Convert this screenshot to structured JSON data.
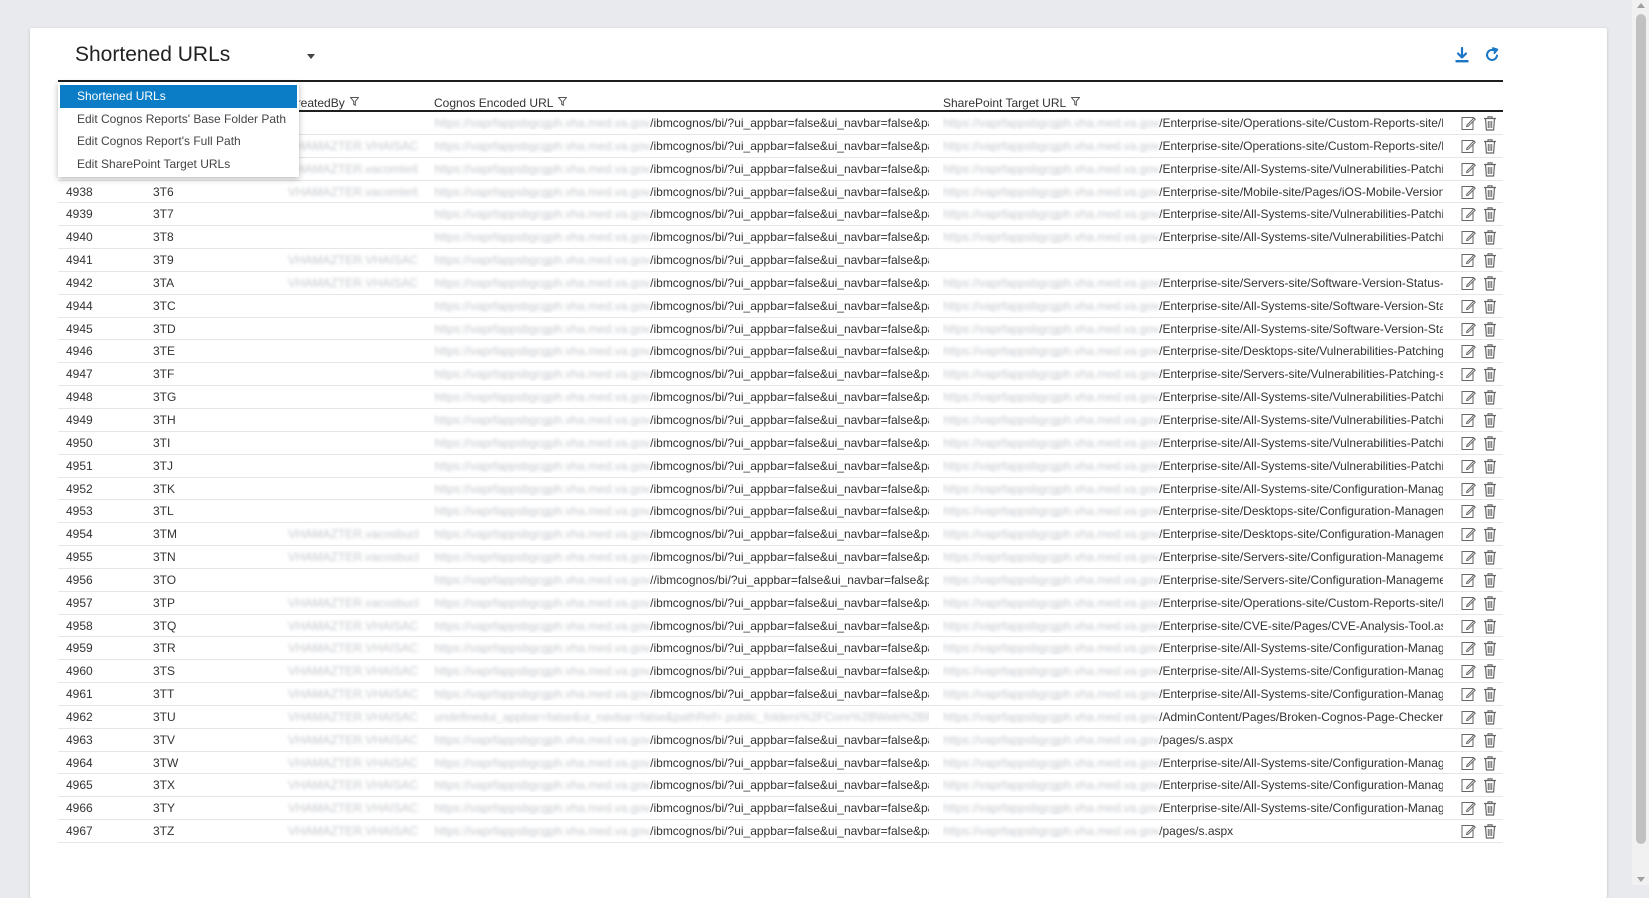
{
  "view_selector": {
    "label": "Shortened URLs"
  },
  "menu": [
    "Shortened URLs",
    "Edit Cognos Reports' Base Folder Path",
    "Edit Cognos Report's Full Path",
    "Edit SharePoint Target URLs"
  ],
  "toolbar": {
    "download_icon": "download-icon",
    "refresh_icon": "refresh-icon"
  },
  "columns": {
    "id": "",
    "code": "",
    "created_by": "CreatedBy",
    "cognos_url": "Cognos Encoded URL",
    "sharepoint_url": "SharePoint Target URL"
  },
  "colors": {
    "accent": "#0b7dc6",
    "selected_text": "#ffffff",
    "rule": "#1f1f1f"
  },
  "rows": [
    {
      "id": "",
      "code": "",
      "created_by": "",
      "cognos_host": "https://vaprfappsbgcgph.vha.med.va.gov",
      "cognos": "/ibmcognos/bi/?ui_appbar=false&ui_navbar=false&pat...",
      "sp_host": "https://vaprfappsbgcgph.vha.med.va.gov",
      "sp": "/Enterprise-site/Operations-site/Custom-Reports-site/P..."
    },
    {
      "id": "",
      "code": "",
      "created_by": "VHAMAZTER.VHAISAC",
      "cognos_host": "https://vaprfappsbgcgph.vha.med.va.gov",
      "cognos": "/ibmcognos/bi/?ui_appbar=false&ui_navbar=false&pat...",
      "sp_host": "https://vaprfappsbgcgph.vha.med.va.gov",
      "sp": "/Enterprise-site/Operations-site/Custom-Reports-site/P..."
    },
    {
      "id": "",
      "code": "",
      "created_by": "VHAMAZTER.vacomlerb",
      "cognos_host": "https://vaprfappsbgcgph.vha.med.va.gov",
      "cognos": "/ibmcognos/bi/?ui_appbar=false&ui_navbar=false&pat...",
      "sp_host": "https://vaprfappsbgcgph.vha.med.va.gov",
      "sp": "/Enterprise-site/All-Systems-site/Vulnerabilities-Patchi..."
    },
    {
      "id": "4938",
      "code": "3T6",
      "created_by": "VHAMAZTER.vacomlerb",
      "cognos_host": "https://vaprfappsbgcgph.vha.med.va.gov",
      "cognos": "/ibmcognos/bi/?ui_appbar=false&ui_navbar=false&pat...",
      "sp_host": "https://vaprfappsbgcgph.vha.med.va.gov",
      "sp": "/Enterprise-site/Mobile-site/Pages/iOS-Mobile-Version-..."
    },
    {
      "id": "4939",
      "code": "3T7",
      "created_by": "",
      "cognos_host": "https://vaprfappsbgcgph.vha.med.va.gov",
      "cognos": "/ibmcognos/bi/?ui_appbar=false&ui_navbar=false&pat...",
      "sp_host": "https://vaprfappsbgcgph.vha.med.va.gov",
      "sp": "/Enterprise-site/All-Systems-site/Vulnerabilities-Patchi..."
    },
    {
      "id": "4940",
      "code": "3T8",
      "created_by": "",
      "cognos_host": "https://vaprfappsbgcgph.vha.med.va.gov",
      "cognos": "/ibmcognos/bi/?ui_appbar=false&ui_navbar=false&pat...",
      "sp_host": "https://vaprfappsbgcgph.vha.med.va.gov",
      "sp": "/Enterprise-site/All-Systems-site/Vulnerabilities-Patchi..."
    },
    {
      "id": "4941",
      "code": "3T9",
      "created_by": "VHAMAZTER.VHAISAC",
      "cognos_host": "https://vaprfappsbgcgph.vha.med.va.gov",
      "cognos": "/ibmcognos/bi/?ui_appbar=false&ui_navbar=false&pat...",
      "sp_host": "",
      "sp": ""
    },
    {
      "id": "4942",
      "code": "3TA",
      "created_by": "VHAMAZTER.VHAISAC",
      "cognos_host": "https://vaprfappsbgcgph.vha.med.va.gov",
      "cognos": "/ibmcognos/bi/?ui_appbar=false&ui_navbar=false&pat...",
      "sp_host": "https://vaprfappsbgcgph.vha.med.va.gov",
      "sp": "/Enterprise-site/Servers-site/Software-Version-Status-s..."
    },
    {
      "id": "4944",
      "code": "3TC",
      "created_by": "",
      "cognos_host": "https://vaprfappsbgcgph.vha.med.va.gov",
      "cognos": "/ibmcognos/bi/?ui_appbar=false&ui_navbar=false&pat...",
      "sp_host": "https://vaprfappsbgcgph.vha.med.va.gov",
      "sp": "/Enterprise-site/All-Systems-site/Software-Version-Stat..."
    },
    {
      "id": "4945",
      "code": "3TD",
      "created_by": "",
      "cognos_host": "https://vaprfappsbgcgph.vha.med.va.gov",
      "cognos": "/ibmcognos/bi/?ui_appbar=false&ui_navbar=false&pat...",
      "sp_host": "https://vaprfappsbgcgph.vha.med.va.gov",
      "sp": "/Enterprise-site/All-Systems-site/Software-Version-Stat..."
    },
    {
      "id": "4946",
      "code": "3TE",
      "created_by": "",
      "cognos_host": "https://vaprfappsbgcgph.vha.med.va.gov",
      "cognos": "/ibmcognos/bi/?ui_appbar=false&ui_navbar=false&pat...",
      "sp_host": "https://vaprfappsbgcgph.vha.med.va.gov",
      "sp": "/Enterprise-site/Desktops-site/Vulnerabilities-Patching-..."
    },
    {
      "id": "4947",
      "code": "3TF",
      "created_by": "",
      "cognos_host": "https://vaprfappsbgcgph.vha.med.va.gov",
      "cognos": "/ibmcognos/bi/?ui_appbar=false&ui_navbar=false&pat...",
      "sp_host": "https://vaprfappsbgcgph.vha.med.va.gov",
      "sp": "/Enterprise-site/Servers-site/Vulnerabilities-Patching-si..."
    },
    {
      "id": "4948",
      "code": "3TG",
      "created_by": "",
      "cognos_host": "https://vaprfappsbgcgph.vha.med.va.gov",
      "cognos": "/ibmcognos/bi/?ui_appbar=false&ui_navbar=false&pat...",
      "sp_host": "https://vaprfappsbgcgph.vha.med.va.gov",
      "sp": "/Enterprise-site/All-Systems-site/Vulnerabilities-Patchi..."
    },
    {
      "id": "4949",
      "code": "3TH",
      "created_by": "",
      "cognos_host": "https://vaprfappsbgcgph.vha.med.va.gov",
      "cognos": "/ibmcognos/bi/?ui_appbar=false&ui_navbar=false&pat...",
      "sp_host": "https://vaprfappsbgcgph.vha.med.va.gov",
      "sp": "/Enterprise-site/All-Systems-site/Vulnerabilities-Patchi..."
    },
    {
      "id": "4950",
      "code": "3TI",
      "created_by": "",
      "cognos_host": "https://vaprfappsbgcgph.vha.med.va.gov",
      "cognos": "/ibmcognos/bi/?ui_appbar=false&ui_navbar=false&pat...",
      "sp_host": "https://vaprfappsbgcgph.vha.med.va.gov",
      "sp": "/Enterprise-site/All-Systems-site/Vulnerabilities-Patchi..."
    },
    {
      "id": "4951",
      "code": "3TJ",
      "created_by": "",
      "cognos_host": "https://vaprfappsbgcgph.vha.med.va.gov",
      "cognos": "/ibmcognos/bi/?ui_appbar=false&ui_navbar=false&pat...",
      "sp_host": "https://vaprfappsbgcgph.vha.med.va.gov",
      "sp": "/Enterprise-site/All-Systems-site/Vulnerabilities-Patchi..."
    },
    {
      "id": "4952",
      "code": "3TK",
      "created_by": "",
      "cognos_host": "https://vaprfappsbgcgph.vha.med.va.gov",
      "cognos": "/ibmcognos/bi/?ui_appbar=false&ui_navbar=false&pat...",
      "sp_host": "https://vaprfappsbgcgph.vha.med.va.gov",
      "sp": "/Enterprise-site/All-Systems-site/Configuration-Manag..."
    },
    {
      "id": "4953",
      "code": "3TL",
      "created_by": "",
      "cognos_host": "https://vaprfappsbgcgph.vha.med.va.gov",
      "cognos": "/ibmcognos/bi/?ui_appbar=false&ui_navbar=false&pat...",
      "sp_host": "https://vaprfappsbgcgph.vha.med.va.gov",
      "sp": "/Enterprise-site/Desktops-site/Configuration-Managem..."
    },
    {
      "id": "4954",
      "code": "3TM",
      "created_by": "VHAMAZTER.vacosbuckb",
      "cognos_host": "https://vaprfappsbgcgph.vha.med.va.gov",
      "cognos": "/ibmcognos/bi/?ui_appbar=false&ui_navbar=false&pat...",
      "sp_host": "https://vaprfappsbgcgph.vha.med.va.gov",
      "sp": "/Enterprise-site/Desktops-site/Configuration-Managem..."
    },
    {
      "id": "4955",
      "code": "3TN",
      "created_by": "VHAMAZTER.vacosbuckb",
      "cognos_host": "https://vaprfappsbgcgph.vha.med.va.gov",
      "cognos": "/ibmcognos/bi/?ui_appbar=false&ui_navbar=false&pat...",
      "sp_host": "https://vaprfappsbgcgph.vha.med.va.gov",
      "sp": "/Enterprise-site/Servers-site/Configuration-Manageme..."
    },
    {
      "id": "4956",
      "code": "3TO",
      "created_by": "",
      "cognos_host": "https://vaprfappsbgcgph.vha.med.va.gov",
      "cognos": "//ibmcognos/bi/?ui_appbar=false&ui_navbar=false&pat...",
      "sp_host": "https://vaprfappsbgcgph.vha.med.va.gov",
      "sp": "/Enterprise-site/Servers-site/Configuration-Manageme..."
    },
    {
      "id": "4957",
      "code": "3TP",
      "created_by": "VHAMAZTER.vacosbuckb",
      "cognos_host": "https://vaprfappsbgcgph.vha.med.va.gov",
      "cognos": "/ibmcognos/bi/?ui_appbar=false&ui_navbar=false&pat...",
      "sp_host": "https://vaprfappsbgcgph.vha.med.va.gov",
      "sp": "/Enterprise-site/Operations-site/Custom-Reports-site/P..."
    },
    {
      "id": "4958",
      "code": "3TQ",
      "created_by": "VHAMAZTER.VHAISAC",
      "cognos_host": "https://vaprfappsbgcgph.vha.med.va.gov",
      "cognos": "/ibmcognos/bi/?ui_appbar=false&ui_navbar=false&pat...",
      "sp_host": "https://vaprfappsbgcgph.vha.med.va.gov",
      "sp": "/Enterprise-site/CVE-site/Pages/CVE-Analysis-Tool.aspx"
    },
    {
      "id": "4959",
      "code": "3TR",
      "created_by": "VHAMAZTER.VHAISAC",
      "cognos_host": "https://vaprfappsbgcgph.vha.med.va.gov",
      "cognos": "/ibmcognos/bi/?ui_appbar=false&ui_navbar=false&pat...",
      "sp_host": "https://vaprfappsbgcgph.vha.med.va.gov",
      "sp": "/Enterprise-site/All-Systems-site/Configuration-Manag..."
    },
    {
      "id": "4960",
      "code": "3TS",
      "created_by": "VHAMAZTER.VHAISAC",
      "cognos_host": "https://vaprfappsbgcgph.vha.med.va.gov",
      "cognos": "/ibmcognos/bi/?ui_appbar=false&ui_navbar=false&pat...",
      "sp_host": "https://vaprfappsbgcgph.vha.med.va.gov",
      "sp": "/Enterprise-site/All-Systems-site/Configuration-Manag..."
    },
    {
      "id": "4961",
      "code": "3TT",
      "created_by": "VHAMAZTER.VHAISAC",
      "cognos_host": "https://vaprfappsbgcgph.vha.med.va.gov",
      "cognos": "/ibmcognos/bi/?ui_appbar=false&ui_navbar=false&pat...",
      "sp_host": "https://vaprfappsbgcgph.vha.med.va.gov",
      "sp": "/Enterprise-site/All-Systems-site/Configuration-Manag..."
    },
    {
      "id": "4962",
      "code": "3TU",
      "created_by": "VHAMAZTER.VHAISAC",
      "cognos_host": "undefinedui_appbar=false&ui_navbar=false&pathRef=.public_folders%2FCore%2BWeb%2BReport",
      "cognos": "",
      "sp_host": "https://vaprfappsbgcgph.vha.med.va.gov",
      "sp": "/AdminContent/Pages/Broken-Cognos-Page-Checker.a..."
    },
    {
      "id": "4963",
      "code": "3TV",
      "created_by": "VHAMAZTER.VHAISAC",
      "cognos_host": "https://vaprfappsbgcgph.vha.med.va.gov",
      "cognos": "/ibmcognos/bi/?ui_appbar=false&ui_navbar=false&pat...",
      "sp_host": "https://vaprfappsbgcgph.vha.med.va.gov",
      "sp": "/pages/s.aspx"
    },
    {
      "id": "4964",
      "code": "3TW",
      "created_by": "VHAMAZTER.VHAISAC",
      "cognos_host": "https://vaprfappsbgcgph.vha.med.va.gov",
      "cognos": "/ibmcognos/bi/?ui_appbar=false&ui_navbar=false&pat...",
      "sp_host": "https://vaprfappsbgcgph.vha.med.va.gov",
      "sp": "/Enterprise-site/All-Systems-site/Configuration-Manag..."
    },
    {
      "id": "4965",
      "code": "3TX",
      "created_by": "VHAMAZTER.VHAISAC",
      "cognos_host": "https://vaprfappsbgcgph.vha.med.va.gov",
      "cognos": "/ibmcognos/bi/?ui_appbar=false&ui_navbar=false&pat...",
      "sp_host": "https://vaprfappsbgcgph.vha.med.va.gov",
      "sp": "/Enterprise-site/All-Systems-site/Configuration-Manag..."
    },
    {
      "id": "4966",
      "code": "3TY",
      "created_by": "VHAMAZTER.VHAISAC",
      "cognos_host": "https://vaprfappsbgcgph.vha.med.va.gov",
      "cognos": "/ibmcognos/bi/?ui_appbar=false&ui_navbar=false&pat...",
      "sp_host": "https://vaprfappsbgcgph.vha.med.va.gov",
      "sp": "/Enterprise-site/All-Systems-site/Configuration-Manag..."
    },
    {
      "id": "4967",
      "code": "3TZ",
      "created_by": "VHAMAZTER.VHAISAC",
      "cognos_host": "https://vaprfappsbgcgph.vha.med.va.gov",
      "cognos": "/ibmcognos/bi/?ui_appbar=false&ui_navbar=false&pat...",
      "sp_host": "https://vaprfappsbgcgph.vha.med.va.gov",
      "sp": "/pages/s.aspx"
    }
  ]
}
